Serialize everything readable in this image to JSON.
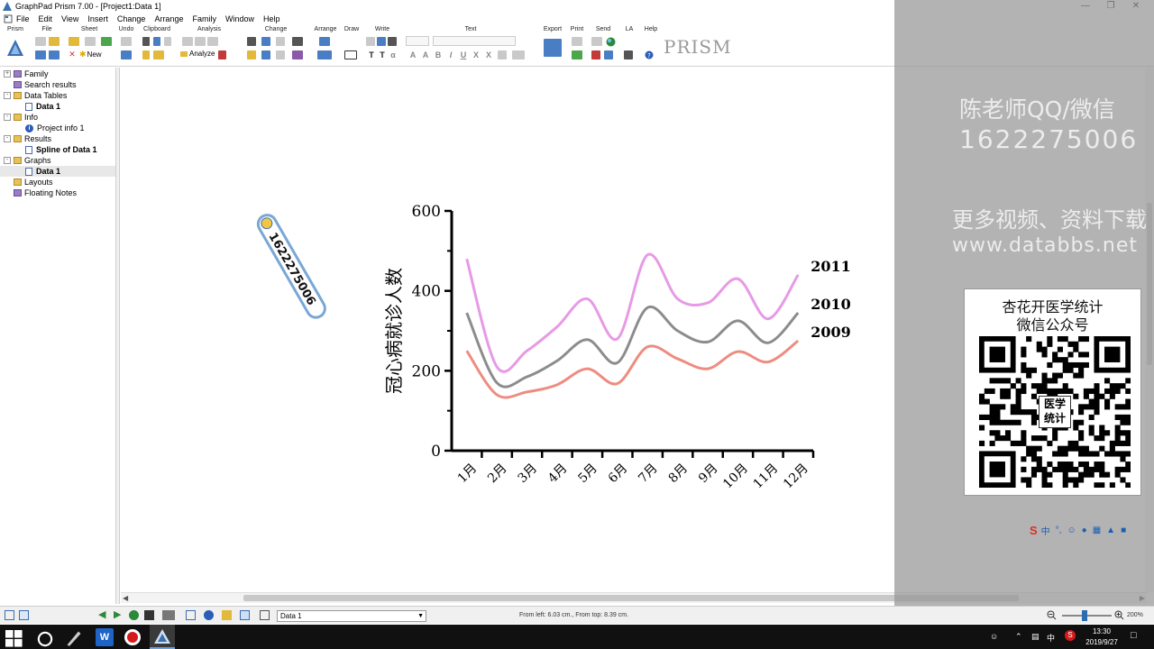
{
  "window": {
    "title": "GraphPad Prism 7.00 - [Project1:Data 1]"
  },
  "menu": {
    "items": [
      "File",
      "Edit",
      "View",
      "Insert",
      "Change",
      "Arrange",
      "Family",
      "Window",
      "Help"
    ]
  },
  "toolbar": {
    "groups": [
      "Prism",
      "File",
      "Sheet",
      "Undo",
      "Clipboard",
      "Analysis",
      "Change",
      "Arrange",
      "Draw",
      "Write",
      "Text",
      "Export",
      "Print",
      "Send",
      "LA",
      "Help"
    ],
    "new_label": "New",
    "analyze_label": "Analyze",
    "logo_text": "PRISM"
  },
  "navigator": {
    "items": [
      {
        "label": "Family",
        "level": 0,
        "kind": "folder-purple",
        "expander": "+"
      },
      {
        "label": "Search results",
        "level": 0,
        "kind": "folder-purple",
        "expander": ""
      },
      {
        "label": "Data Tables",
        "level": 0,
        "kind": "folder",
        "expander": "-"
      },
      {
        "label": "Data 1",
        "level": 1,
        "kind": "sheet",
        "bold": true
      },
      {
        "label": "Info",
        "level": 0,
        "kind": "folder",
        "expander": "-"
      },
      {
        "label": "Project info 1",
        "level": 1,
        "kind": "info"
      },
      {
        "label": "Results",
        "level": 0,
        "kind": "folder",
        "expander": "-"
      },
      {
        "label": "Spline of Data 1",
        "level": 1,
        "kind": "sheet",
        "bold": true
      },
      {
        "label": "Graphs",
        "level": 0,
        "kind": "folder",
        "expander": "-"
      },
      {
        "label": "Data 1",
        "level": 1,
        "kind": "sheet",
        "bold": true,
        "selected": true
      },
      {
        "label": "Layouts",
        "level": 0,
        "kind": "folder",
        "expander": ""
      },
      {
        "label": "Floating Notes",
        "level": 0,
        "kind": "folder-purple",
        "expander": ""
      }
    ]
  },
  "sticker": {
    "text": "1622275006"
  },
  "chart_data": {
    "type": "line",
    "ylabel": "冠心病就诊人数",
    "ylim": [
      0,
      600
    ],
    "yticks": [
      "0",
      "200",
      "400",
      "600"
    ],
    "categories": [
      "1月",
      "2月",
      "3月",
      "4月",
      "5月",
      "6月",
      "7月",
      "8月",
      "9月",
      "10月",
      "11月",
      "12月"
    ],
    "series": [
      {
        "name": "2011",
        "color": "#e79ae6",
        "values": [
          480,
          210,
          250,
          310,
          380,
          280,
          490,
          380,
          370,
          430,
          330,
          440
        ]
      },
      {
        "name": "2010",
        "color": "#8c8c8c",
        "values": [
          345,
          170,
          185,
          225,
          278,
          220,
          358,
          300,
          272,
          325,
          270,
          345
        ]
      },
      {
        "name": "2009",
        "color": "#ee8c80",
        "values": [
          250,
          140,
          147,
          165,
          205,
          168,
          260,
          230,
          205,
          248,
          222,
          275
        ]
      }
    ]
  },
  "watermark": {
    "line1": "陈老师QQ/微信",
    "line2": "1622275006",
    "line3": "更多视频、资料下载",
    "line4": "www.databbs.net",
    "qr_title1": "杏花开医学统计",
    "qr_title2": "微信公众号",
    "qr_center1": "医学",
    "qr_center2": "统计"
  },
  "ime": {
    "label": "中"
  },
  "statusbar": {
    "sheet_select": "Data 1",
    "position_text": "From left: 6.03 cm., From top: 8.39 cm.",
    "zoom": "200%"
  },
  "taskbar": {
    "time": "13:30",
    "date": "2019/9/27",
    "lang": "中"
  }
}
